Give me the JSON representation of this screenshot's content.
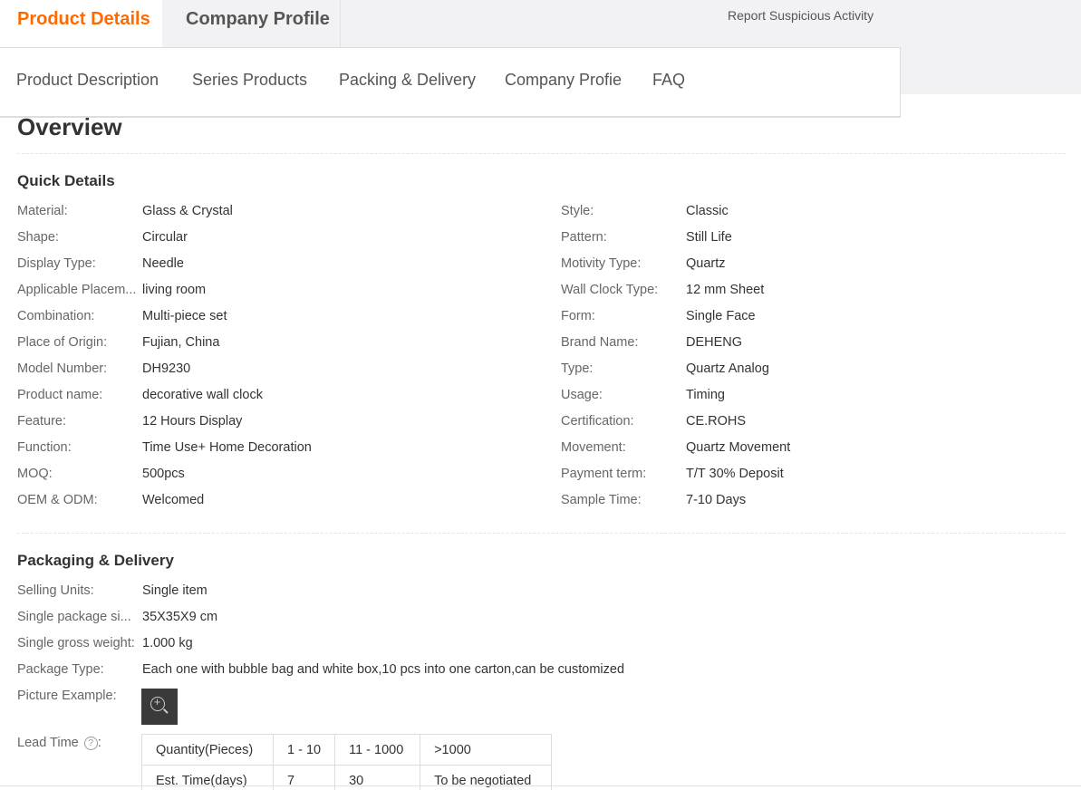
{
  "tabs": {
    "product_details": "Product Details",
    "company_profile": "Company Profile"
  },
  "report_link": "Report Suspicious Activity",
  "subnav": [
    "Product Description",
    "Series Products",
    "Packing & Delivery",
    "Company Profie",
    "FAQ"
  ],
  "overview_title": "Overview",
  "quick_details": {
    "title": "Quick Details",
    "left": [
      {
        "k": "Material:",
        "v": "Glass & Crystal"
      },
      {
        "k": "Shape:",
        "v": "Circular"
      },
      {
        "k": "Display Type:",
        "v": "Needle"
      },
      {
        "k": "Applicable Placem...",
        "v": "living room"
      },
      {
        "k": "Combination:",
        "v": "Multi-piece set"
      },
      {
        "k": "Place of Origin:",
        "v": "Fujian, China"
      },
      {
        "k": "Model Number:",
        "v": "DH9230"
      },
      {
        "k": "Product name:",
        "v": "decorative wall clock"
      },
      {
        "k": "Feature:",
        "v": "12 Hours Display"
      },
      {
        "k": "Function:",
        "v": "Time Use+ Home Decoration"
      },
      {
        "k": "MOQ:",
        "v": "500pcs"
      },
      {
        "k": "OEM & ODM:",
        "v": "Welcomed"
      }
    ],
    "right": [
      {
        "k": "Style:",
        "v": "Classic"
      },
      {
        "k": "Pattern:",
        "v": "Still Life"
      },
      {
        "k": "Motivity Type:",
        "v": "Quartz"
      },
      {
        "k": "Wall Clock Type:",
        "v": "12 mm Sheet"
      },
      {
        "k": "Form:",
        "v": "Single Face"
      },
      {
        "k": "Brand Name:",
        "v": "DEHENG"
      },
      {
        "k": "Type:",
        "v": "Quartz Analog"
      },
      {
        "k": "Usage:",
        "v": "Timing"
      },
      {
        "k": "Certification:",
        "v": "CE.ROHS"
      },
      {
        "k": "Movement:",
        "v": "Quartz Movement"
      },
      {
        "k": "Payment term:",
        "v": "T/T 30% Deposit"
      },
      {
        "k": "Sample Time:",
        "v": "7-10 Days"
      }
    ]
  },
  "packaging": {
    "title": "Packaging & Delivery",
    "rows": [
      {
        "k": "Selling Units:",
        "v": "Single item"
      },
      {
        "k": "Single package si...",
        "v": "35X35X9 cm"
      },
      {
        "k": "Single gross weight:",
        "v": "1.000 kg"
      },
      {
        "k": "Package Type:",
        "v": "Each one with bubble bag and white box,10 pcs into one carton,can be customized"
      }
    ],
    "picture_label": "Picture Example:",
    "picture_icon": "zoom-in-icon",
    "lead_time_label": "Lead Time",
    "help_glyph": "?",
    "lead_time_table": [
      [
        "Quantity(Pieces)",
        "1 - 10",
        "11 - 1000",
        ">1000"
      ],
      [
        "Est. Time(days)",
        "7",
        "30",
        "To be negotiated"
      ]
    ]
  },
  "colors": {
    "accent": "#ff6a00",
    "topbar_bg": "#f2f2f4"
  }
}
